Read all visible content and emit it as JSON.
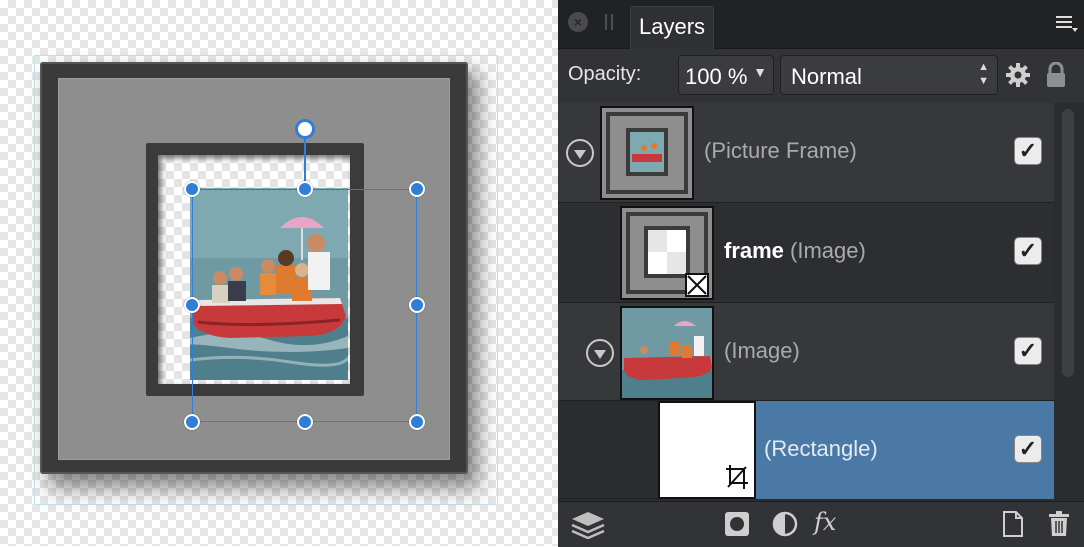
{
  "panel": {
    "tab_label": "Layers",
    "opacity_label": "Opacity:",
    "opacity_value": "100 %",
    "blend_mode": "Normal"
  },
  "layers": [
    {
      "name": "",
      "type": "(Picture Frame)",
      "visible": true,
      "expanded": true,
      "selected": false
    },
    {
      "name": "frame",
      "type": "(Image)",
      "visible": true,
      "expanded": false,
      "selected": false
    },
    {
      "name": "",
      "type": "(Image)",
      "visible": true,
      "expanded": true,
      "selected": false
    },
    {
      "name": "",
      "type": "(Rectangle)",
      "visible": true,
      "expanded": false,
      "selected": true
    }
  ],
  "footer": {
    "fx_label": "fx"
  },
  "colors": {
    "selection_blue": "#2f7fd6",
    "selected_row": "#4a79a6",
    "panel_bg": "#2b2c2e"
  },
  "icons": [
    "close-icon",
    "layers-icon",
    "mask-icon",
    "adjustment-icon",
    "fx-icon",
    "add-layer-icon",
    "trash-icon",
    "gear-icon",
    "lock-icon",
    "menu-icon",
    "crop-icon"
  ]
}
